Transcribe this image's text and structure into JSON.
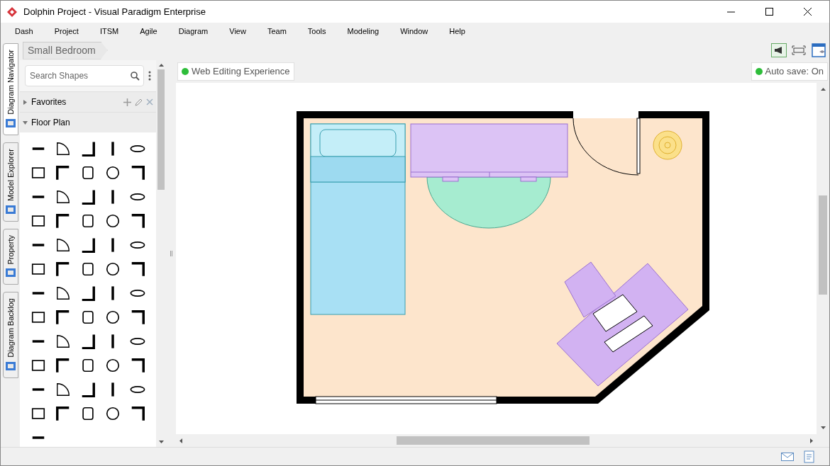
{
  "window": {
    "title": "Dolphin Project - Visual Paradigm Enterprise"
  },
  "menu": [
    "Dash",
    "Project",
    "ITSM",
    "Agile",
    "Diagram",
    "View",
    "Team",
    "Tools",
    "Modeling",
    "Window",
    "Help"
  ],
  "side_tabs": [
    {
      "label": "Diagram Navigator",
      "selected": true
    },
    {
      "label": "Model Explorer",
      "selected": false
    },
    {
      "label": "Property",
      "selected": false
    },
    {
      "label": "Diagram Backlog",
      "selected": false
    }
  ],
  "breadcrumb": "Small Bedroom",
  "palette": {
    "search": {
      "placeholder": "Search Shapes"
    },
    "groups": [
      {
        "label": "Favorites",
        "expanded": false
      },
      {
        "label": "Floor Plan",
        "expanded": true
      }
    ]
  },
  "canvas": {
    "badges": [
      {
        "label": "Web Editing Experience",
        "color": "#2ebd3a"
      },
      {
        "label": "Auto save: On",
        "color": "#2ebd3a"
      }
    ]
  }
}
